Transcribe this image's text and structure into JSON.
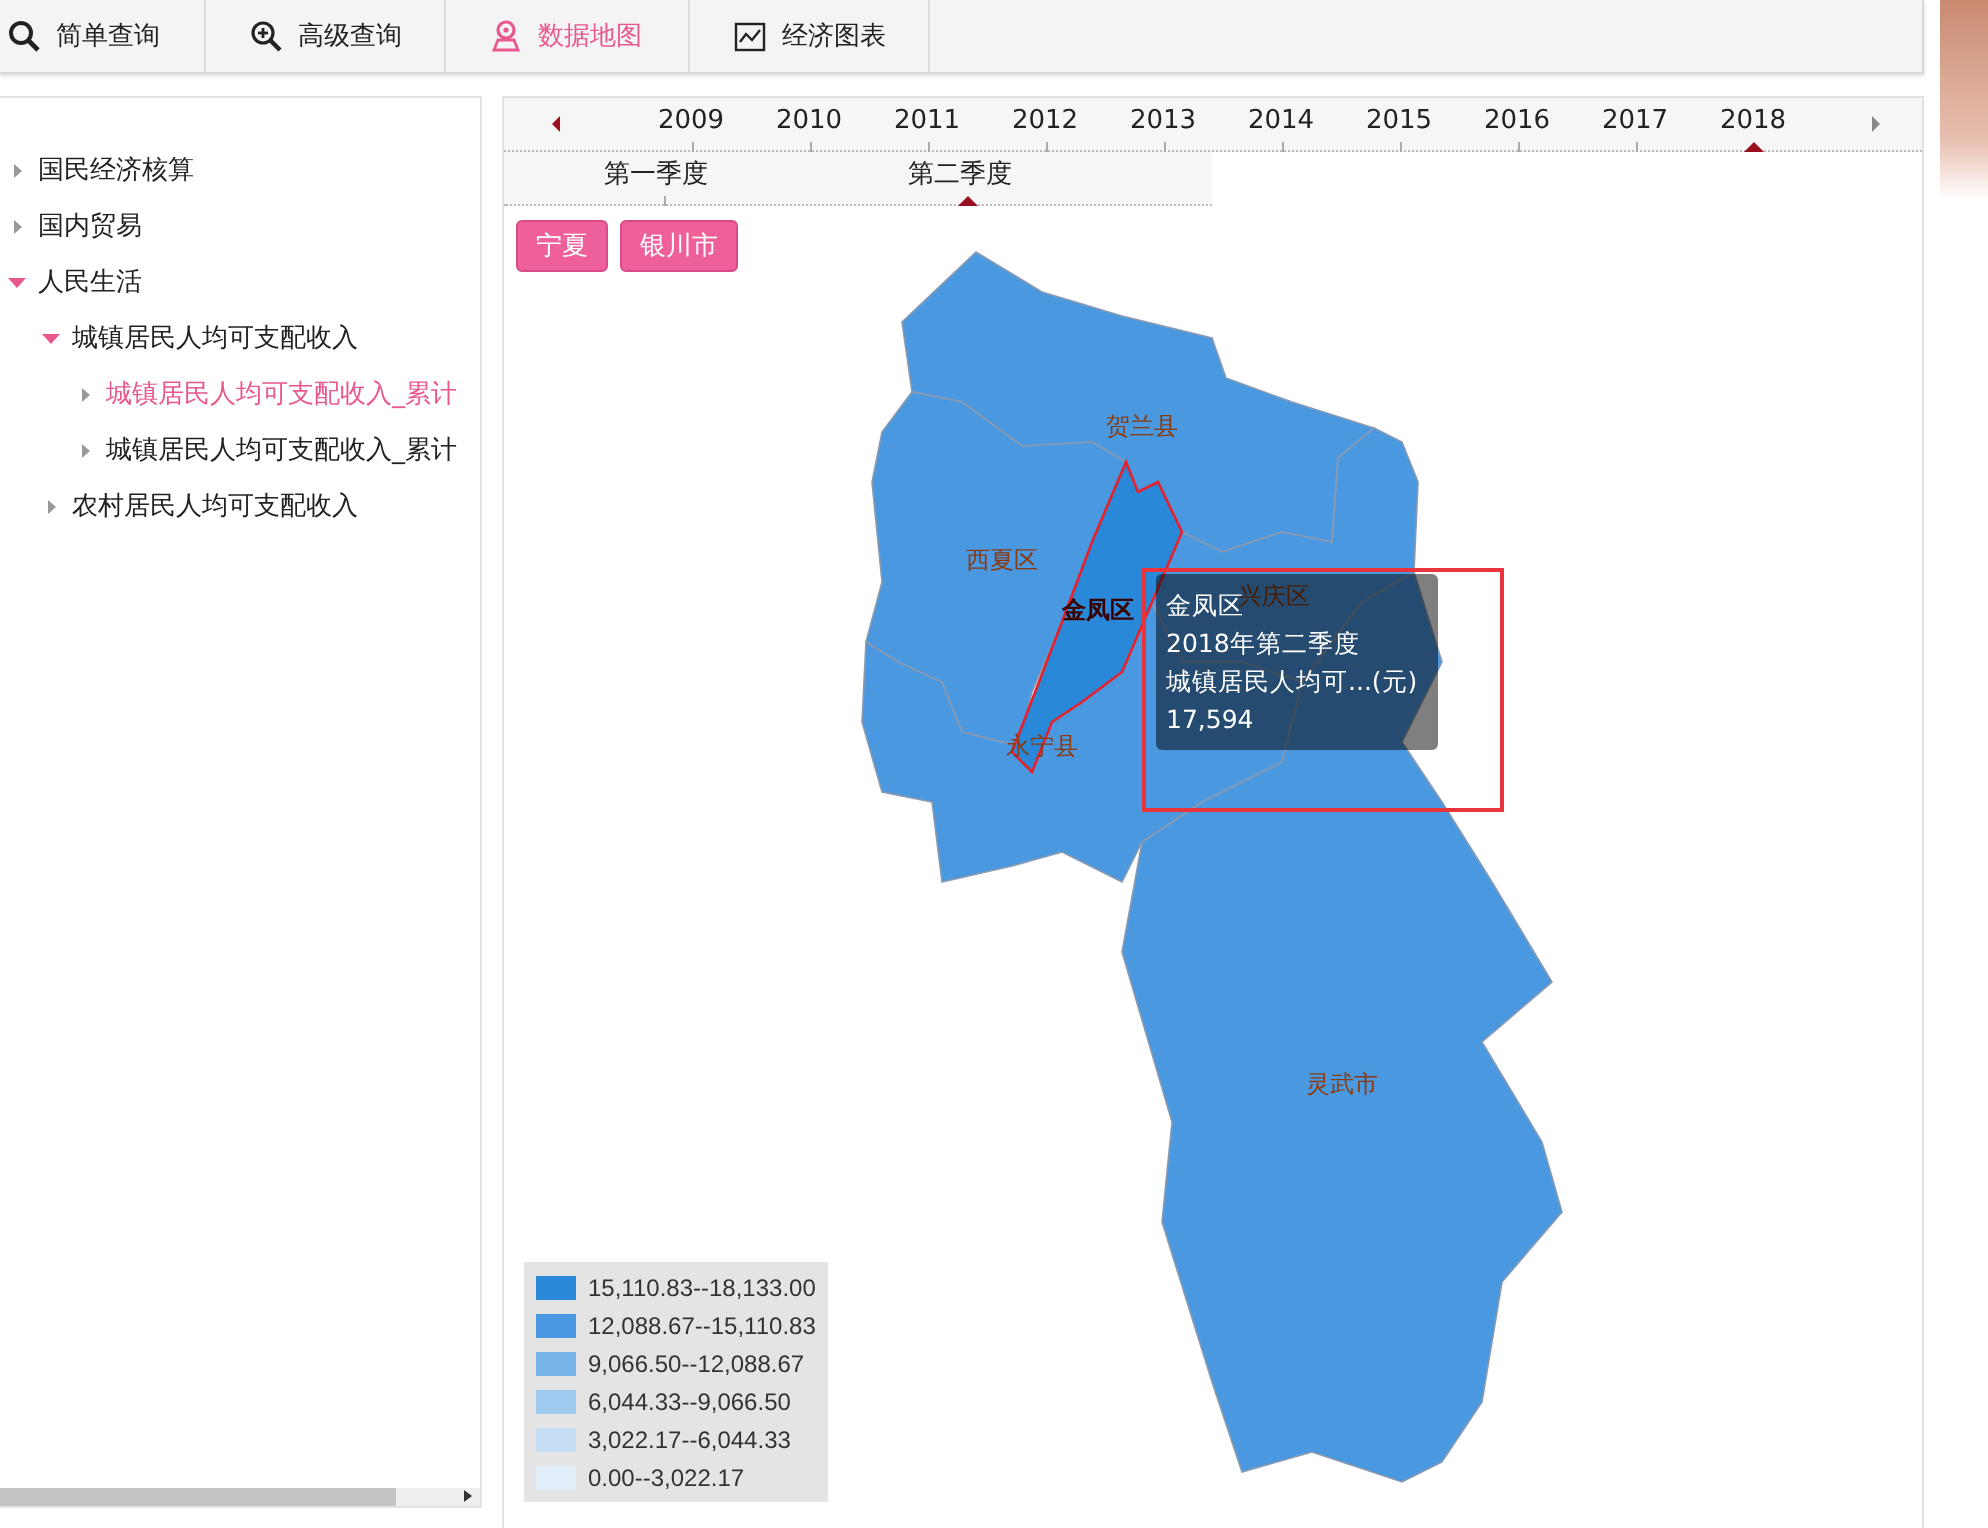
{
  "tabs": [
    {
      "label": "简单查询",
      "selected": false
    },
    {
      "label": "高级查询",
      "selected": false
    },
    {
      "label": "数据地图",
      "selected": true
    },
    {
      "label": "经济图表",
      "selected": false
    }
  ],
  "tree": [
    {
      "label": "国民经济核算",
      "expanded": false,
      "selected": false
    },
    {
      "label": "国内贸易",
      "expanded": false,
      "selected": false
    },
    {
      "label": "人民生活",
      "expanded": true,
      "selected": false,
      "children": [
        {
          "label": "城镇居民人均可支配收入",
          "expanded": true,
          "selected": false,
          "children": [
            {
              "label": "城镇居民人均可支配收入_累计",
              "expanded": false,
              "selected": true
            },
            {
              "label": "城镇居民人均可支配收入_累计",
              "expanded": false,
              "selected": false
            }
          ]
        },
        {
          "label": "农村居民人均可支配收入",
          "expanded": false,
          "selected": false
        }
      ]
    }
  ],
  "timeline": {
    "years": [
      {
        "label": "2009",
        "selected": false
      },
      {
        "label": "2010",
        "selected": false
      },
      {
        "label": "2011",
        "selected": false
      },
      {
        "label": "2012",
        "selected": false
      },
      {
        "label": "2013",
        "selected": false
      },
      {
        "label": "2014",
        "selected": false
      },
      {
        "label": "2015",
        "selected": false
      },
      {
        "label": "2016",
        "selected": false
      },
      {
        "label": "2017",
        "selected": false
      },
      {
        "label": "2018",
        "selected": true
      }
    ],
    "quarters": [
      {
        "label": "第一季度",
        "selected": false
      },
      {
        "label": "第二季度",
        "selected": true
      }
    ]
  },
  "breadcrumb": [
    "宁夏",
    "银川市"
  ],
  "map": {
    "regions": [
      {
        "name": "贺兰县",
        "color": "#4a98e0",
        "selected": false
      },
      {
        "name": "西夏区",
        "color": "#4a98e0",
        "selected": false
      },
      {
        "name": "兴庆区",
        "color": "#4a98e0",
        "selected": false
      },
      {
        "name": "永宁县",
        "color": "#4a98e0",
        "selected": false
      },
      {
        "name": "灵武市",
        "color": "#4a98e0",
        "selected": false
      },
      {
        "name": "金凤区",
        "color": "#2a88d8",
        "selected": true
      }
    ],
    "tooltip": [
      "金凤区",
      "2018年第二季度",
      "城镇居民人均可...(元)",
      "17,594"
    ],
    "legend": [
      {
        "label": "15,110.83--18,133.00",
        "color": "#2a88d8"
      },
      {
        "label": "12,088.67--15,110.83",
        "color": "#4a98e0"
      },
      {
        "label": "9,066.50--12,088.67",
        "color": "#78b4e8"
      },
      {
        "label": "6,044.33--9,066.50",
        "color": "#9ecbef"
      },
      {
        "label": "3,022.17--6,044.33",
        "color": "#c5def4"
      },
      {
        "label": "0.00--3,022.17",
        "color": "#e2eefa"
      }
    ]
  }
}
